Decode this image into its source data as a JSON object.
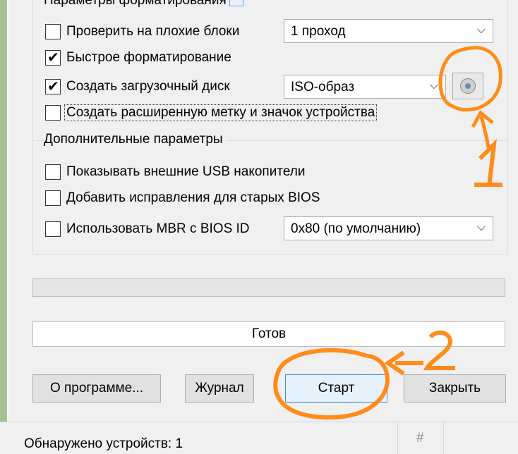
{
  "top_cut_label": "Параметры форматирования",
  "format_options": {
    "bad_blocks": {
      "label": "Проверить на плохие блоки",
      "checked": false,
      "combo_value": "1 проход"
    },
    "quick_format": {
      "label": "Быстрое форматирование",
      "checked": true
    },
    "bootable": {
      "label": "Создать загрузочный диск",
      "checked": true,
      "combo_value": "ISO-образ"
    },
    "extended_label": {
      "label": "Создать расширенную метку и значок устройства",
      "checked": false
    }
  },
  "advanced": {
    "title": "Дополнительные параметры",
    "external_usb": {
      "label": "Показывать внешние USB накопители",
      "checked": false
    },
    "old_bios": {
      "label": "Добавить исправления для старых BIOS",
      "checked": false
    },
    "mbr_bios_id": {
      "label": "Использовать MBR с BIOS ID",
      "checked": false,
      "combo_value": "0x80 (по умолчанию)"
    }
  },
  "progress": {
    "percent": 0
  },
  "status_text": "Готов",
  "buttons": {
    "about": "О программе...",
    "log": "Журнал",
    "start": "Старт",
    "close": "Закрыть"
  },
  "statusbar": {
    "text": "Обнаружено устройств: 1",
    "hash": "#"
  },
  "annotations": {
    "one": "1",
    "two": "2",
    "color": "#ff8c1a"
  }
}
